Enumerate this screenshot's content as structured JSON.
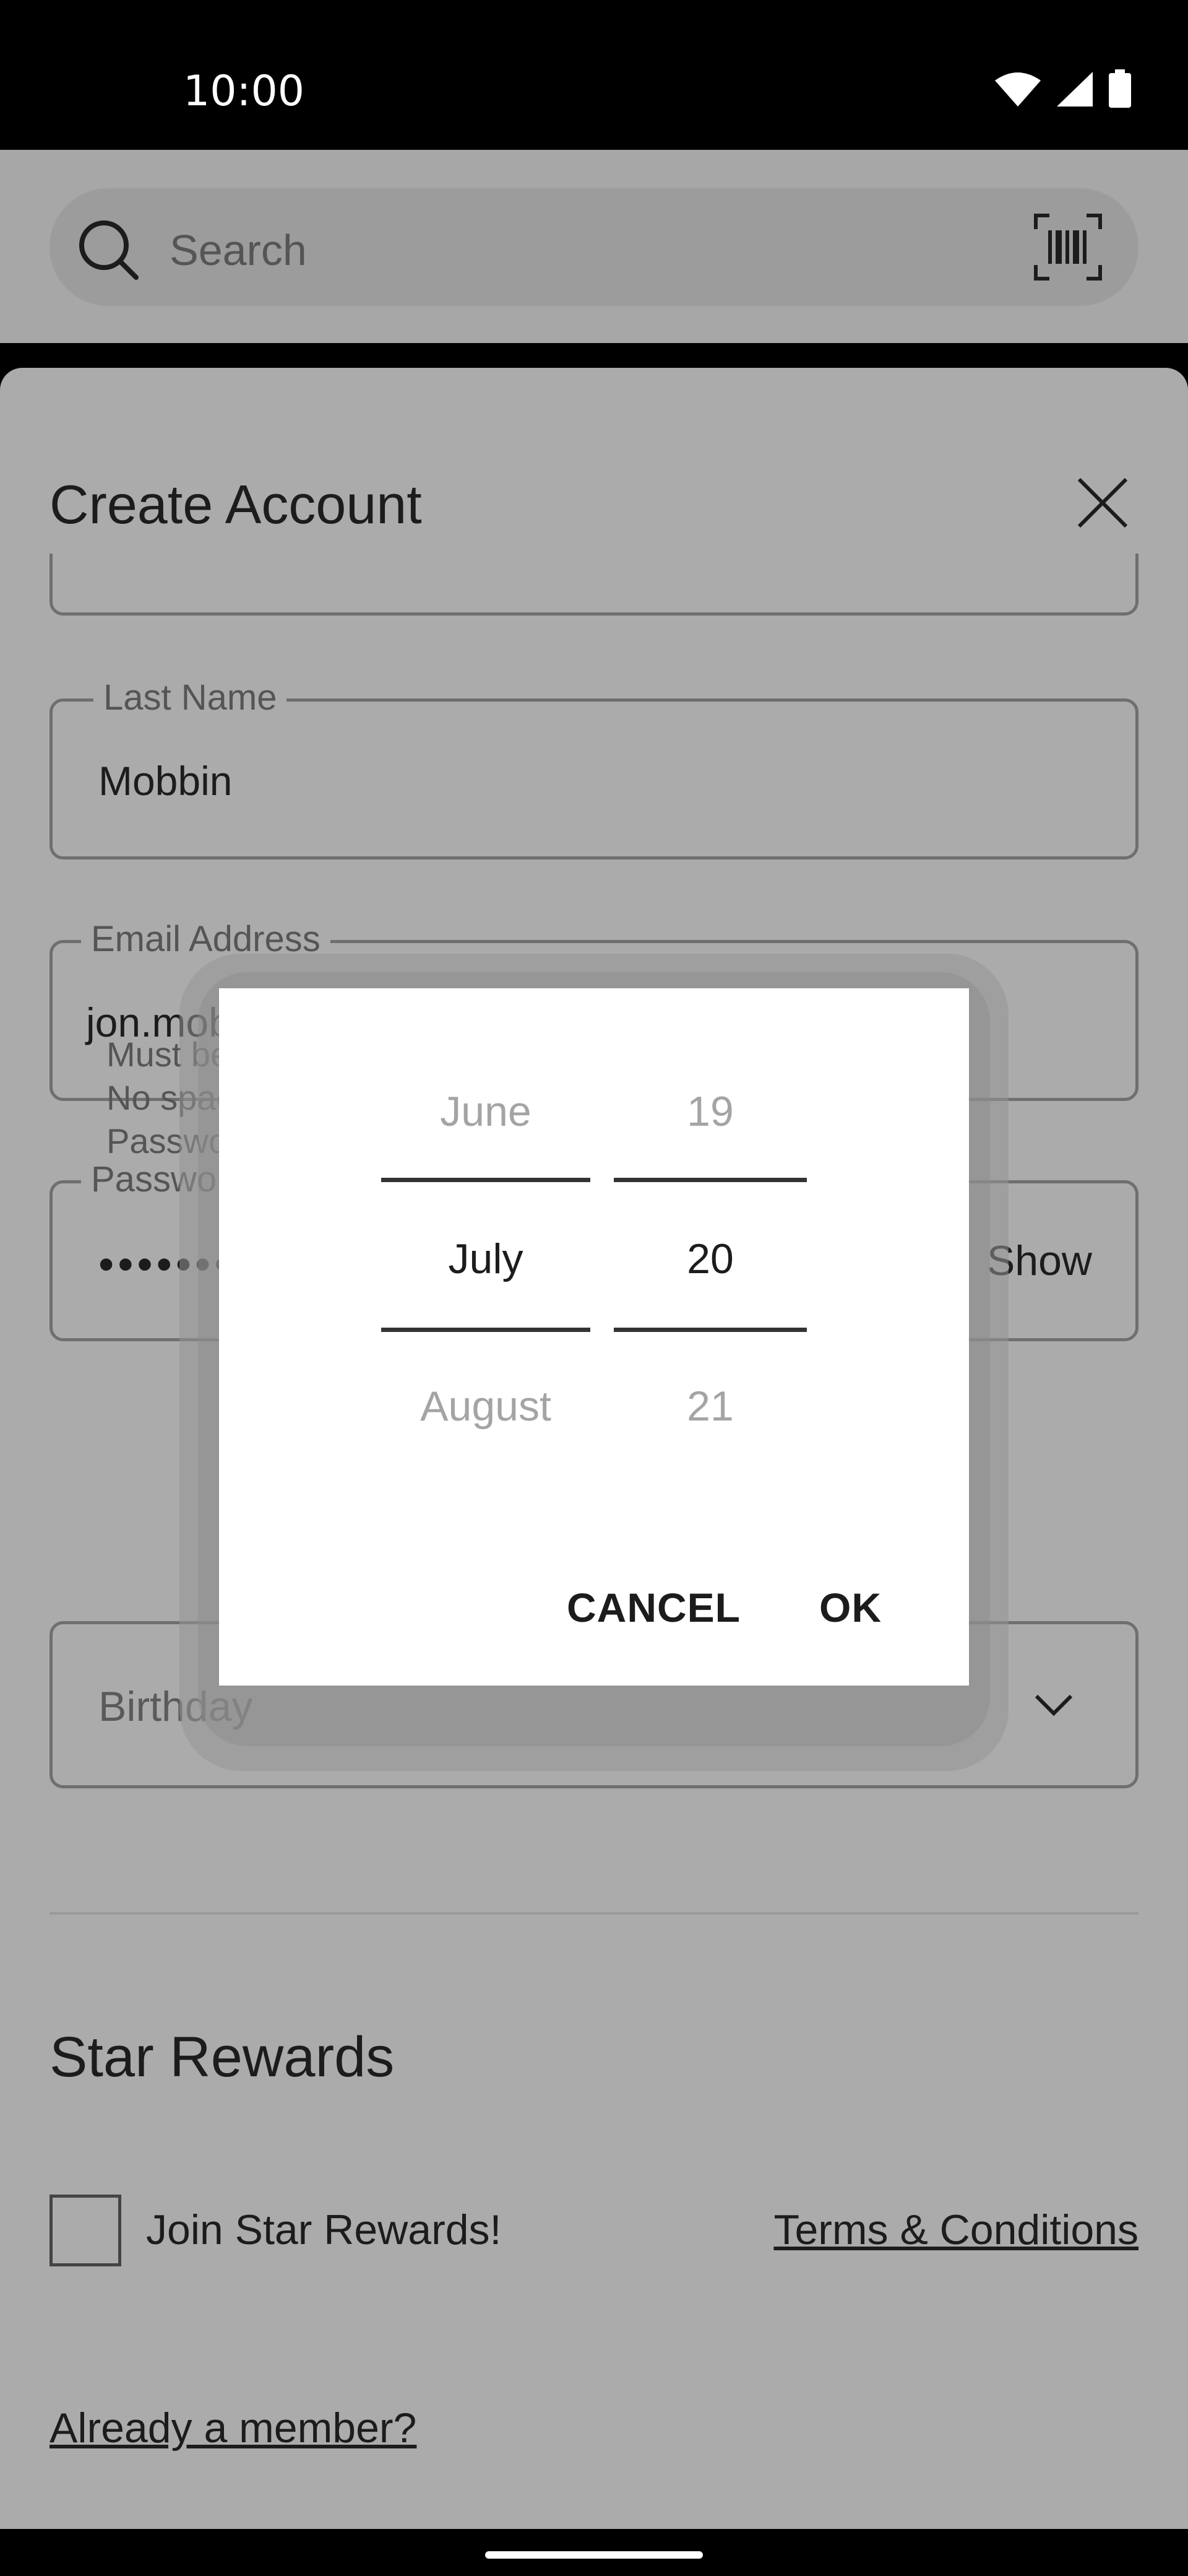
{
  "status_bar": {
    "time": "10:00"
  },
  "search": {
    "placeholder": "Search"
  },
  "sheet": {
    "title": "Create Account",
    "last_name": {
      "label": "Last Name",
      "value": "Mobbin"
    },
    "email": {
      "label": "Email Address",
      "value": "jon.mobbin@gmail.com"
    },
    "password": {
      "label": "Password",
      "value": "••••••••",
      "action": "Show"
    },
    "hints": [
      "Must be at least 8 characters",
      "No spaces",
      "Passwords are case sensitive"
    ],
    "birthday": {
      "placeholder": "Birthday"
    },
    "rewards": {
      "title": "Star Rewards",
      "checkbox_label": "Join Star Rewards!",
      "terms": "Terms & Conditions",
      "member": "Already a member?"
    }
  },
  "date_picker": {
    "months": [
      "June",
      "July",
      "August"
    ],
    "days": [
      "19",
      "20",
      "21"
    ],
    "cancel": "CANCEL",
    "ok": "OK"
  }
}
